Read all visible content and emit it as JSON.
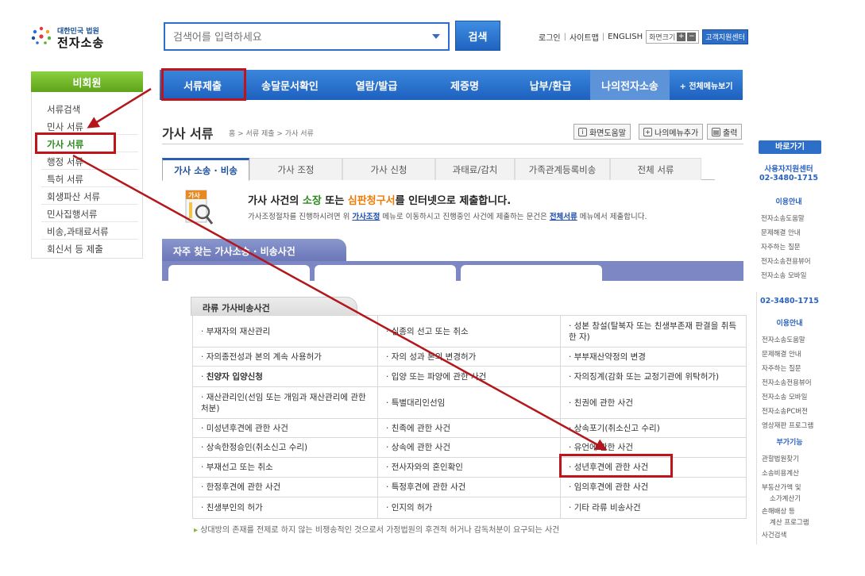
{
  "header": {
    "logo_small": "대한민국 법원",
    "logo_big": "전자소송",
    "search_placeholder": "검색어를 입력하세요",
    "search_button": "검색",
    "links": [
      "로그인",
      "사이트맵",
      "ENGLISH"
    ],
    "zoom_label": "화면크기",
    "customer_center": "고객지원센터"
  },
  "sidebar": {
    "head": "비회원",
    "items": [
      "서류검색",
      "민사 서류",
      "가사 서류",
      "행정 서류",
      "특허 서류",
      "회생파산 서류",
      "민사집행서류",
      "비송,과태료서류",
      "회신서 등 제출"
    ]
  },
  "nav": {
    "items": [
      "서류제출",
      "송달문서확인",
      "열람/발급",
      "제증명",
      "납부/환급",
      "나의전자소송"
    ],
    "all_menu": "+ 전체메뉴보기"
  },
  "page": {
    "title": "가사 서류",
    "breadcrumb": "홈 > 서류 제출 > 가사 서류",
    "util_help": "화면도움말",
    "util_mymenu": "나의메뉴추가",
    "util_print": "출력"
  },
  "tabs": [
    "가사 소송 · 비송",
    "가사 조정",
    "가사 신청",
    "과태료/감치",
    "가족관계등록비송",
    "전체 서류"
  ],
  "info": {
    "icon_text": "가사",
    "title_1": "가사 사건의 ",
    "title_2": "소장",
    "title_3": " 또는 ",
    "title_4": "심판청구서",
    "title_5": "를 인터넷으로 제출합니다.",
    "desc_1": "가사조정절차를 진행하시려면 위 ",
    "desc_link1": "가사조정",
    "desc_2": " 메뉴로 이동하시고 진행중인 사건에 제출하는 문건은 ",
    "desc_link2": "전체서류",
    "desc_3": " 메뉴에서 제출합니다."
  },
  "faq_banner": "자주 찾는 가사소송 · 비송사건",
  "quick": {
    "head": "바로가기",
    "center_1": "사용자지원센터",
    "center_2": "02-3480-1715",
    "section": "이용안내",
    "items": [
      "전자소송도움말",
      "문제해결 안내",
      "자주하는 질문",
      "전자소송전용뷰어",
      "전자소송 모바일"
    ]
  },
  "inset": {
    "tab": "라류 가사비송사건",
    "rows": [
      [
        "부재자의 재산관리",
        "실종의 선고 또는 취소",
        "성본 창설(탈북자 또는 친생부존재 판결을 취득한 자)"
      ],
      [
        "자의종전성과 본의 계속 사용허가",
        "자의 성과 본의 변경허가",
        "부부재산약정의 변경"
      ],
      [
        "친양자 입양신청",
        "입양 또는 파양에 관한 사건",
        "자의징계(감화 또는 교정기관에 위탁허가)"
      ],
      [
        "재산관리인(선임 또는 개임과 재산관리에 관한 처분)",
        "특별대리인선임",
        "친권에 관한 사건"
      ],
      [
        "미성년후견에 관한 사건",
        "친족에 관한 사건",
        "상속포기(취소신고 수리)"
      ],
      [
        "상속한정승인(취소신고 수리)",
        "상속에 관한 사건",
        "유언에 관한 사건"
      ],
      [
        "부재선고 또는 취소",
        "전사자와의 혼인확인",
        "성년후견에 관한 사건"
      ],
      [
        "한정후견에 관한 사건",
        "특정후견에 관한 사건",
        "임의후견에 관한 사건"
      ],
      [
        "친생부인의 허가",
        "인지의 허가",
        "기타 라류 비송사건"
      ]
    ],
    "footnote": "상대방의 존재를 전제로 하지 않는 비쟁송적인 것으로서 가정법원의 후견적 허거나 감독처분이 요구되는 사건"
  },
  "right_panel": {
    "phone": "02-3480-1715",
    "section1": "이용안내",
    "items1": [
      "전자소송도움말",
      "문제해결 안내",
      "자주하는 질문",
      "전자소송전용뷰어",
      "전자소송 모바일",
      "전자소송PC버전",
      "영상재판 프로그램"
    ],
    "section2": "부가기능",
    "items2": [
      "관할법원찾기",
      "소송비용계산",
      "부동산가액 및",
      "소가계산기",
      "손해배상 등",
      "계산 프로그램",
      "사건검색"
    ]
  },
  "colors": {
    "nav_blue": "#1d61bf",
    "green": "#5fa31a",
    "highlight_red": "#c0141b"
  }
}
